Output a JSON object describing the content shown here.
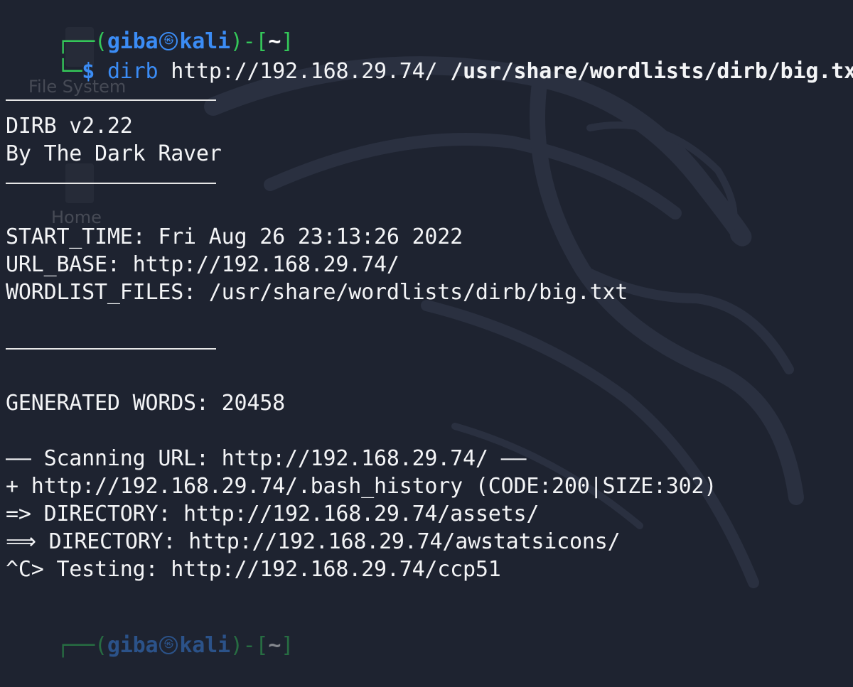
{
  "prompt": {
    "user": "giba",
    "host": "kali",
    "dir": "~",
    "symbol": "$"
  },
  "command": {
    "name": "dirb",
    "url": "http://192.168.29.74/",
    "wordlist": "/usr/share/wordlists/dirb/big.txt"
  },
  "banner": {
    "version": "DIRB v2.22",
    "author": "By The Dark Raver"
  },
  "info": {
    "start_time": "START_TIME: Fri Aug 26 23:13:26 2022",
    "url_base": "URL_BASE: http://192.168.29.74/",
    "wordlist_files": "WORDLIST_FILES: /usr/share/wordlists/dirb/big.txt"
  },
  "generated_words": "GENERATED WORDS: 20458",
  "scan": {
    "header": "—— Scanning URL: http://192.168.29.74/ ——",
    "results": [
      "+ http://192.168.29.74/.bash_history (CODE:200|SIZE:302)",
      "=> DIRECTORY: http://192.168.29.74/assets/",
      "⟹ DIRECTORY: http://192.168.29.74/awstatsicons/",
      "^C> Testing: http://192.168.29.74/ccp51"
    ]
  },
  "background": {
    "desktop_label_1": "File System",
    "desktop_label_2": "Home"
  },
  "colors": {
    "background": "#1e2330",
    "prompt_frame": "#34c759",
    "prompt_user": "#3b8cf5",
    "text": "#f3f4f6"
  }
}
